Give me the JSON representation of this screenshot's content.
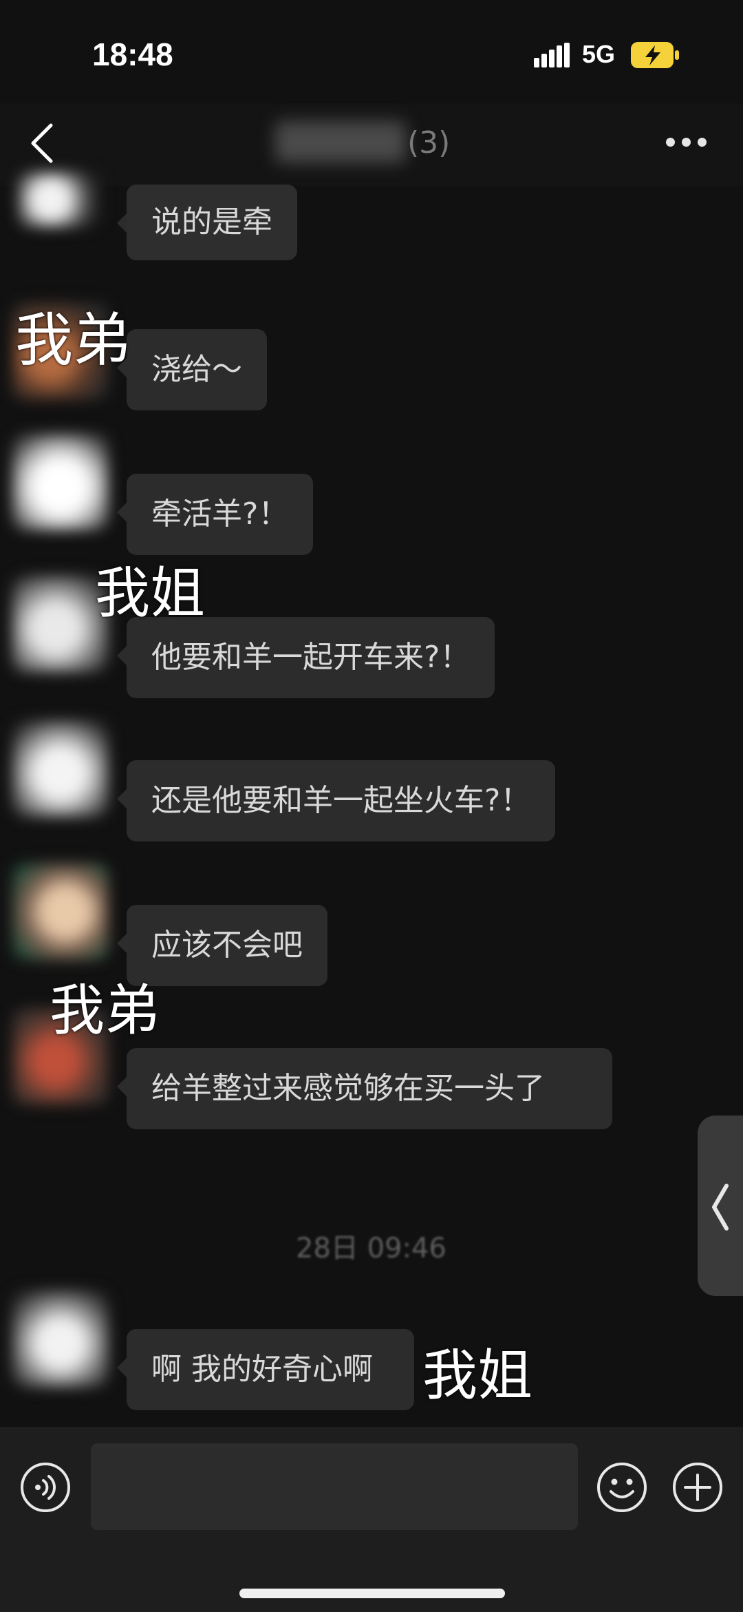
{
  "status_bar": {
    "time": "18:48",
    "network": "5G"
  },
  "header": {
    "title": "",
    "member_count": "(3)"
  },
  "messages": [
    {
      "text": "说的是牵",
      "label": ""
    },
    {
      "text": "浇给～",
      "label": "我弟"
    },
    {
      "text": "牵活羊?！",
      "label": ""
    },
    {
      "text": "他要和羊一起开车来?！",
      "label": "我姐"
    },
    {
      "text": "还是他要和羊一起坐火车?！",
      "label": ""
    },
    {
      "text": "应该不会吧",
      "label": ""
    },
    {
      "text": "给羊整过来感觉够在买一头了",
      "label": "我弟"
    },
    {
      "text": "啊 我的好奇心啊",
      "label": "我姐"
    }
  ],
  "timestamp": "28日 09:46",
  "input": {
    "placeholder": "",
    "value": ""
  },
  "icons": {
    "back": "chevron-left-icon",
    "more": "more-dots-icon",
    "voice": "voice-icon",
    "emoji": "emoji-icon",
    "plus": "plus-icon",
    "side_handle": "chevron-left-icon"
  },
  "colors": {
    "background": "#111111",
    "bubble": "#2c2c2c",
    "battery": "#f5d23a"
  }
}
